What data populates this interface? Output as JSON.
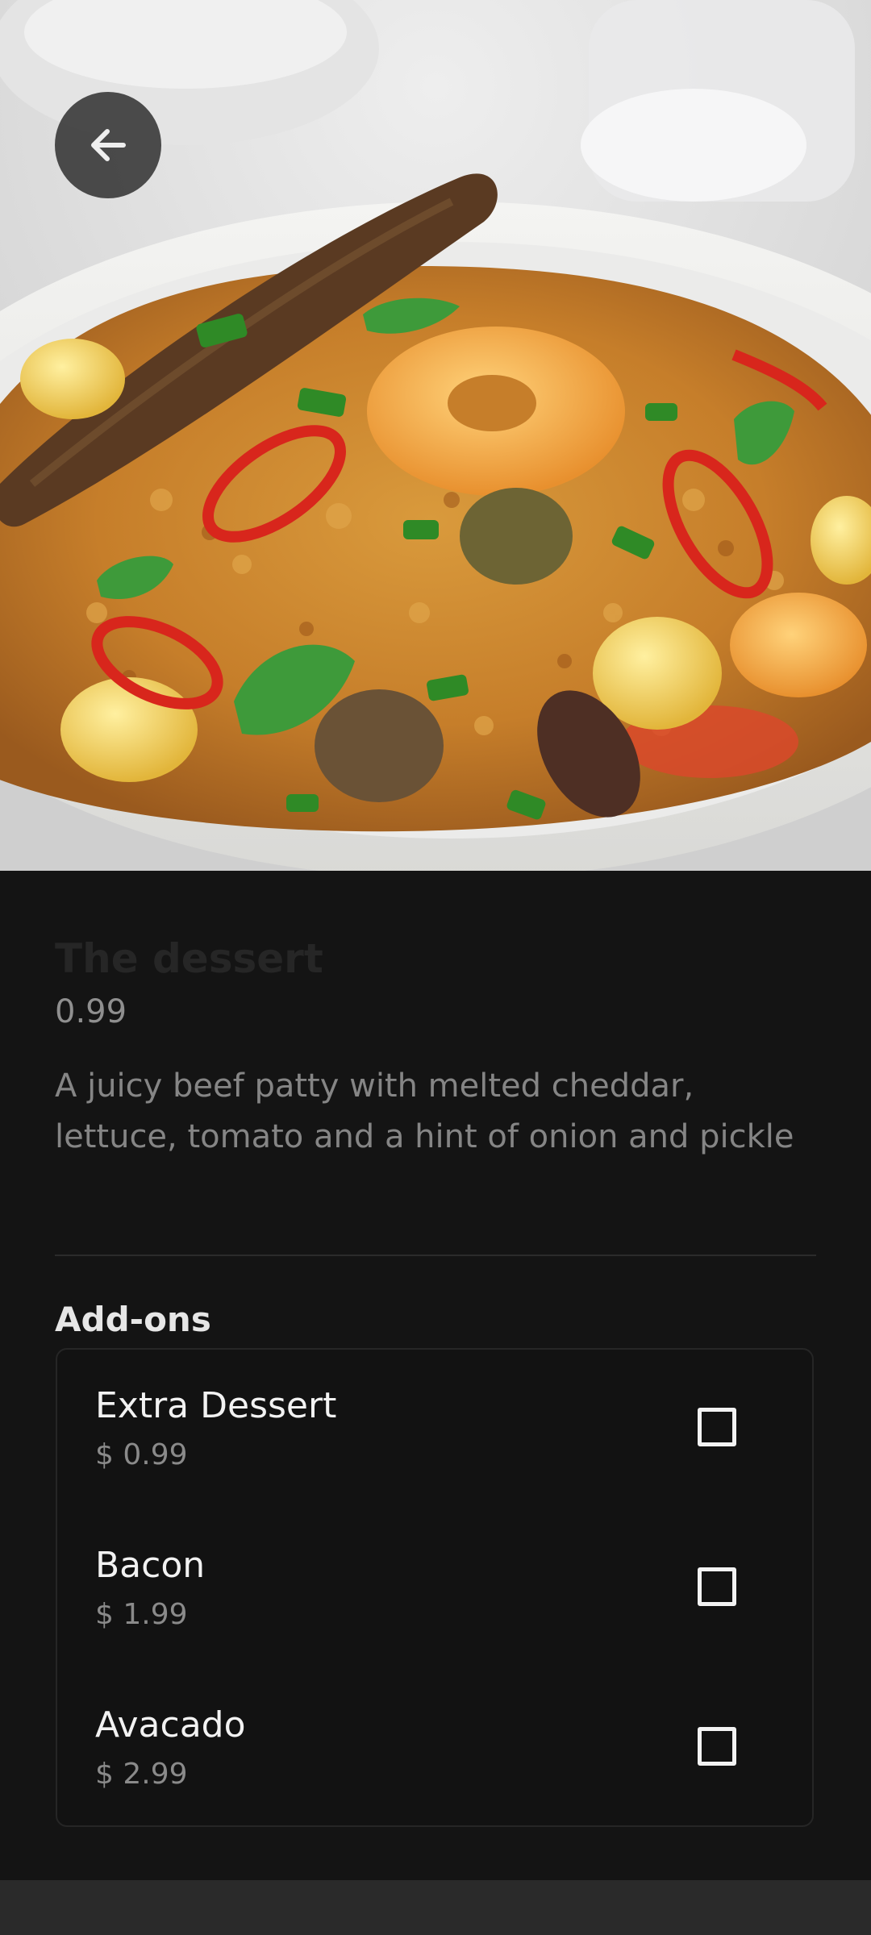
{
  "hero": {
    "image_description": "Plate of spiced rice with shrimp, red chili rings, olives, herbs and eggplant",
    "back_icon": "arrow-left-icon"
  },
  "product": {
    "title": "The dessert",
    "price": "0.99",
    "description": "A juicy beef patty with melted cheddar, lettuce, tomato and a hint of onion and pickle"
  },
  "addons": {
    "heading": "Add-ons",
    "items": [
      {
        "name": "Extra Dessert",
        "price": "$ 0.99",
        "checked": false
      },
      {
        "name": "Bacon",
        "price": "$ 1.99",
        "checked": false
      },
      {
        "name": "Avacado",
        "price": "$ 2.99",
        "checked": false
      }
    ]
  },
  "colors": {
    "background": "#141414",
    "title": "#262626",
    "secondary_text": "#858585",
    "primary_text": "#f2f2f2"
  }
}
